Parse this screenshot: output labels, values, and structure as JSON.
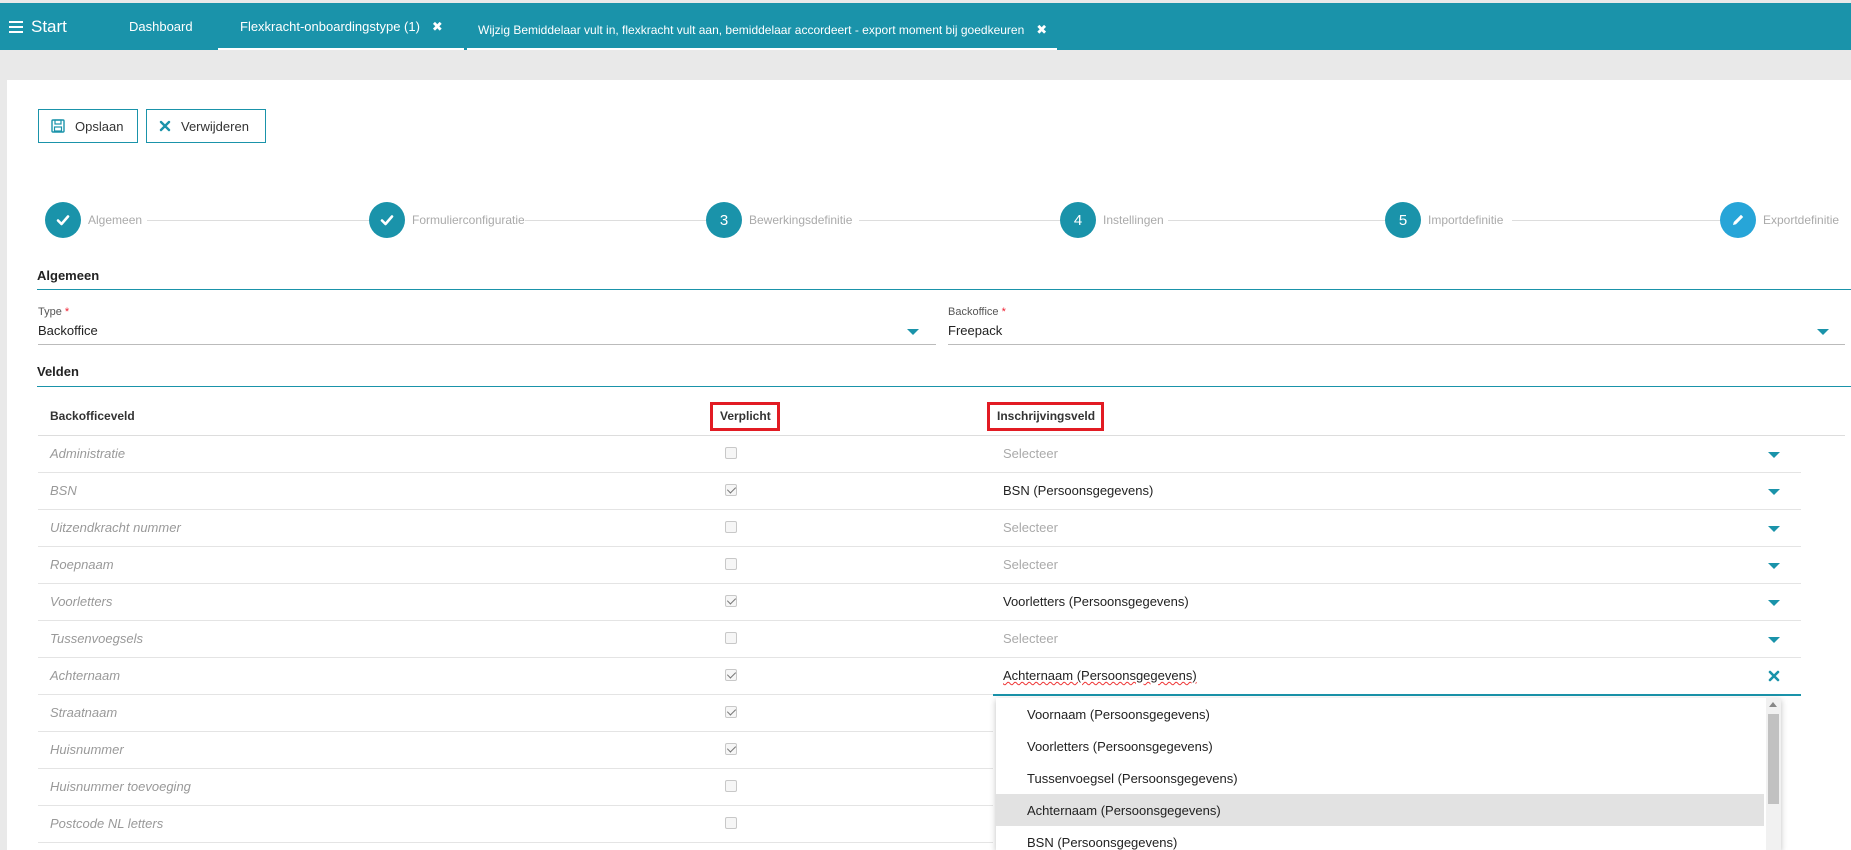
{
  "topbar": {
    "start_label": "Start",
    "tabs": [
      {
        "label": "Dashboard"
      },
      {
        "label": "Flexkracht-onboardingstype (1)"
      },
      {
        "label": "Wijzig Bemiddelaar vult in, flexkracht vult aan, bemiddelaar accordeert - export moment bij goedkeuren"
      }
    ],
    "close_glyph": "✖"
  },
  "toolbar": {
    "save_label": "Opslaan",
    "delete_label": "Verwijderen"
  },
  "stepper": {
    "steps": [
      {
        "marker": "check",
        "label": "Algemeen"
      },
      {
        "marker": "check",
        "label": "Formulierconfiguratie"
      },
      {
        "marker": "3",
        "label": "Bewerkingsdefinitie"
      },
      {
        "marker": "4",
        "label": "Instellingen"
      },
      {
        "marker": "5",
        "label": "Importdefinitie"
      },
      {
        "marker": "pencil",
        "label": "Exportdefinitie"
      }
    ]
  },
  "algemeen": {
    "title": "Algemeen",
    "type_label": "Type",
    "type_value": "Backoffice",
    "backoffice_label": "Backoffice",
    "backoffice_value": "Freepack",
    "required_mark": "*"
  },
  "velden": {
    "title": "Velden",
    "headers": {
      "field": "Backofficeveld",
      "required": "Verplicht",
      "mapping": "Inschrijvingsveld"
    },
    "rows": [
      {
        "name": "Administratie",
        "required": false,
        "mapping": "Selecteer",
        "placeholder": true
      },
      {
        "name": "BSN",
        "required": true,
        "mapping": "BSN (Persoonsgegevens)",
        "placeholder": false
      },
      {
        "name": "Uitzendkracht nummer",
        "required": false,
        "mapping": "Selecteer",
        "placeholder": true
      },
      {
        "name": "Roepnaam",
        "required": false,
        "mapping": "Selecteer",
        "placeholder": true
      },
      {
        "name": "Voorletters",
        "required": true,
        "mapping": "Voorletters (Persoonsgegevens)",
        "placeholder": false
      },
      {
        "name": "Tussenvoegsels",
        "required": false,
        "mapping": "Selecteer",
        "placeholder": true
      },
      {
        "name": "Achternaam",
        "required": true,
        "mapping": "Achternaam (Persoonsgegevens)",
        "placeholder": false
      },
      {
        "name": "Straatnaam",
        "required": true,
        "mapping": "",
        "placeholder": false
      },
      {
        "name": "Huisnummer",
        "required": true,
        "mapping": "",
        "placeholder": false
      },
      {
        "name": "Huisnummer toevoeging",
        "required": false,
        "mapping": "",
        "placeholder": false
      },
      {
        "name": "Postcode NL letters",
        "required": false,
        "mapping": "",
        "placeholder": false
      }
    ]
  },
  "dropdown": {
    "options": [
      {
        "label": "Voornaam (Persoonsgegevens)",
        "active": false
      },
      {
        "label": "Voorletters (Persoonsgegevens)",
        "active": false
      },
      {
        "label": "Tussenvoegsel (Persoonsgegevens)",
        "active": false
      },
      {
        "label": "Achternaam (Persoonsgegevens)",
        "active": true
      },
      {
        "label": "BSN (Persoonsgegevens)",
        "active": false
      }
    ]
  },
  "colors": {
    "accent": "#1a93aa",
    "highlight_box": "#e21b23"
  }
}
